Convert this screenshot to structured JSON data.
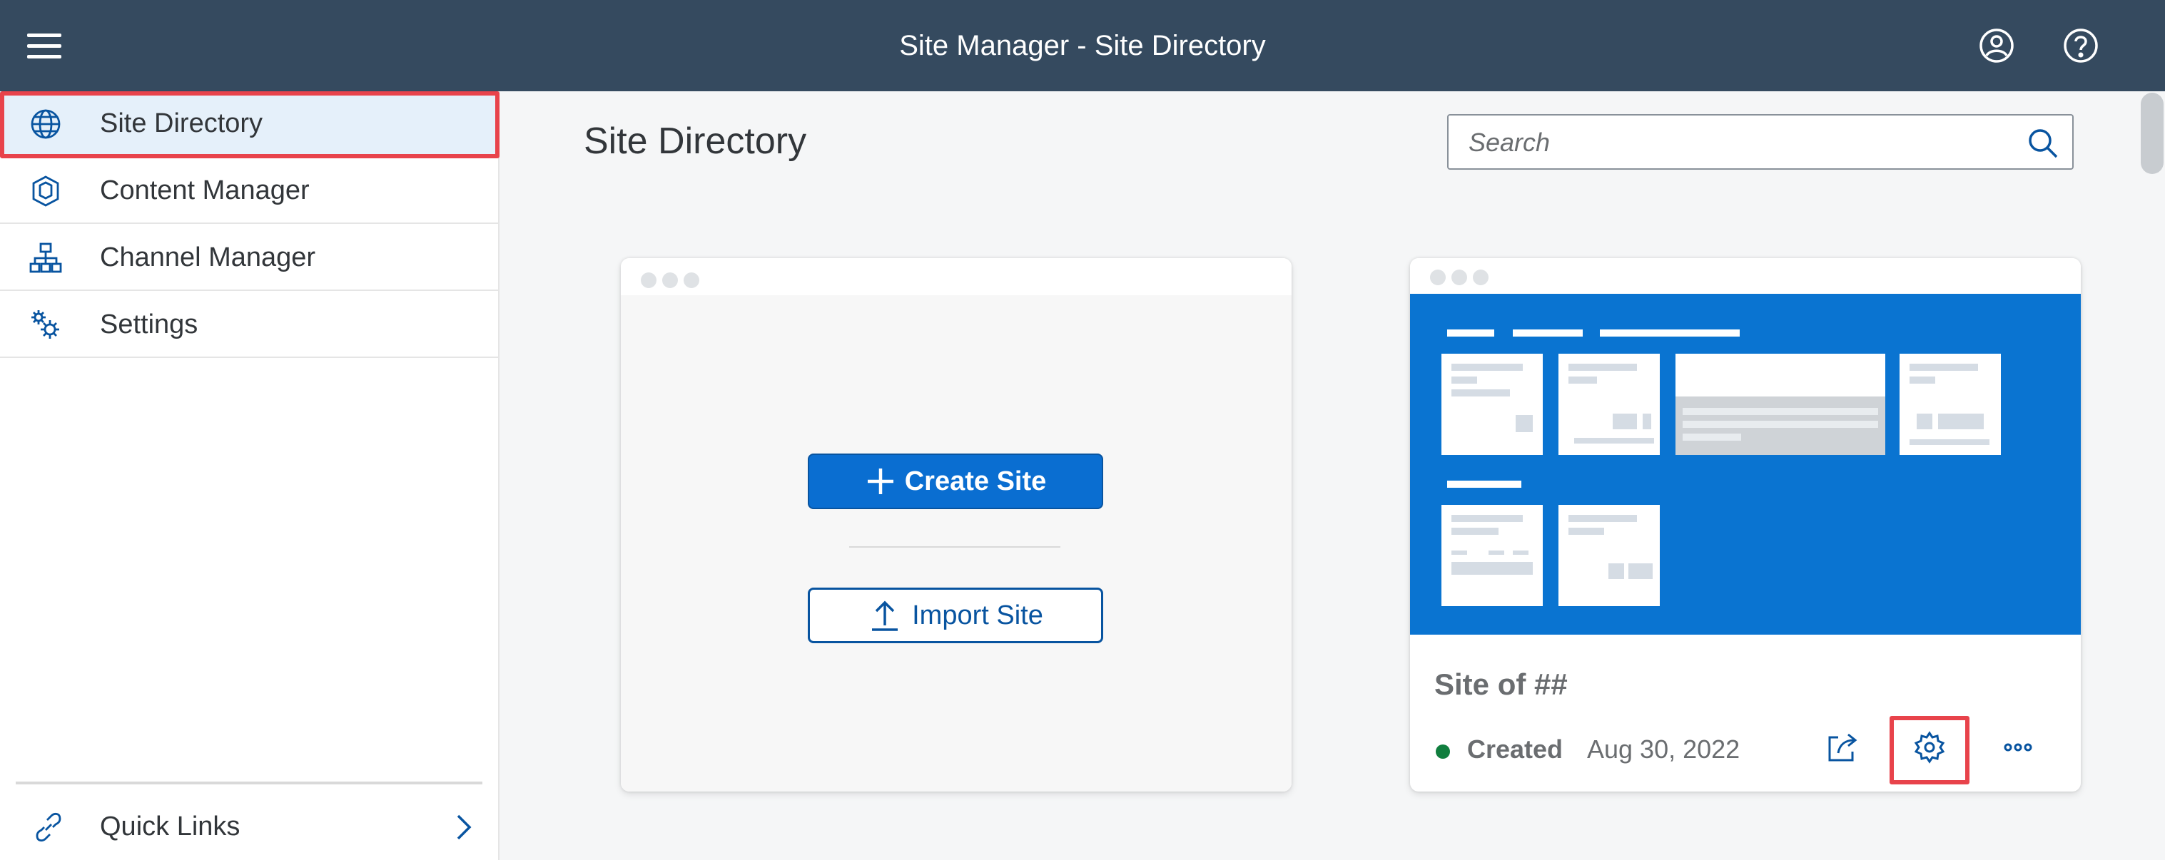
{
  "shell": {
    "title": "Site Manager - Site Directory",
    "menu_icon": "hamburger-menu-icon",
    "user_icon": "user-avatar-icon",
    "help_icon": "help-icon",
    "bg_color": "#354a5f"
  },
  "sidebar": {
    "items": [
      {
        "label": "Site Directory",
        "icon": "globe-icon",
        "selected": true
      },
      {
        "label": "Content Manager",
        "icon": "cube-icon",
        "selected": false
      },
      {
        "label": "Channel Manager",
        "icon": "hierarchy-icon",
        "selected": false
      },
      {
        "label": "Settings",
        "icon": "gears-icon",
        "selected": false
      }
    ],
    "footer": {
      "label": "Quick Links",
      "icon": "link-icon",
      "chevron": "chevron-right-icon"
    }
  },
  "main": {
    "title": "Site Directory",
    "search": {
      "placeholder": "Search",
      "value": ""
    }
  },
  "new_site_card": {
    "create_label": "Create Site",
    "import_label": "Import Site"
  },
  "site_card": {
    "name": "Site of ##",
    "status": "Created",
    "status_color": "#107e3e",
    "date": "Aug 30, 2022",
    "preview_color": "#0a74d1",
    "actions": [
      "share-icon",
      "settings-icon",
      "more-icon"
    ]
  },
  "colors": {
    "accent": "#0a6ed1",
    "highlight": "#e8434b"
  }
}
